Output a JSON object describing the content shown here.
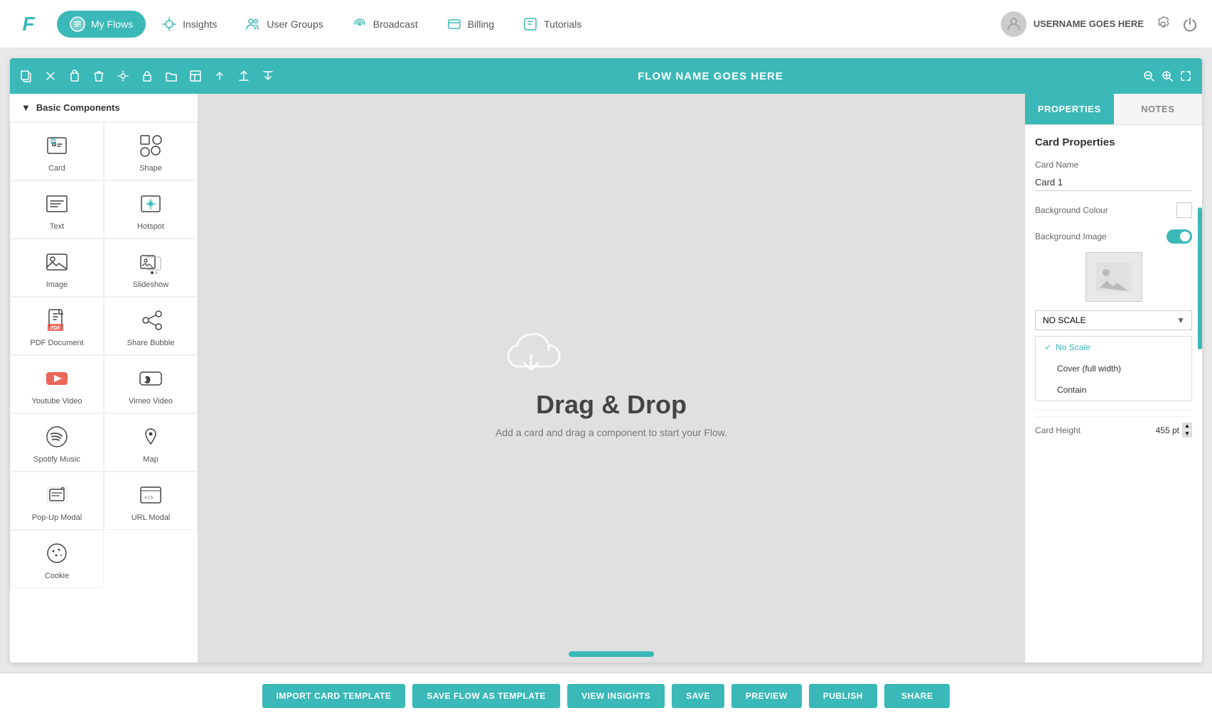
{
  "app": {
    "logo": "F"
  },
  "nav": {
    "items": [
      {
        "id": "my-flows",
        "label": "My Flows",
        "active": true
      },
      {
        "id": "insights",
        "label": "Insights",
        "active": false
      },
      {
        "id": "user-groups",
        "label": "User Groups",
        "active": false
      },
      {
        "id": "broadcast",
        "label": "Broadcast",
        "active": false
      },
      {
        "id": "billing",
        "label": "Billing",
        "active": false
      },
      {
        "id": "tutorials",
        "label": "Tutorials",
        "active": false
      }
    ],
    "username": "USERNAME GOES HERE"
  },
  "toolbar": {
    "title": "FLOW NAME GOES HERE"
  },
  "sidebar": {
    "section_label": "Basic Components",
    "items": [
      {
        "id": "card",
        "label": "Card"
      },
      {
        "id": "shape",
        "label": "Shape"
      },
      {
        "id": "text",
        "label": "Text"
      },
      {
        "id": "hotspot",
        "label": "Hotspot"
      },
      {
        "id": "image",
        "label": "Image"
      },
      {
        "id": "slideshow",
        "label": "Slideshow"
      },
      {
        "id": "pdf-document",
        "label": "PDF Document"
      },
      {
        "id": "share-bubble",
        "label": "Share Bubble"
      },
      {
        "id": "youtube-video",
        "label": "Youtube Video"
      },
      {
        "id": "vimeo-video",
        "label": "Vimeo Video"
      },
      {
        "id": "spotify-music",
        "label": "Spotify Music"
      },
      {
        "id": "map",
        "label": "Map"
      },
      {
        "id": "pop-up-modal",
        "label": "Pop-Up Modal"
      },
      {
        "id": "url-modal",
        "label": "URL Modal"
      },
      {
        "id": "cookie",
        "label": "Cookie"
      }
    ]
  },
  "canvas": {
    "drag_drop_title": "Drag & Drop",
    "drag_drop_subtitle": "Add a card and drag a component to start your Flow."
  },
  "right_panel": {
    "tabs": [
      {
        "id": "properties",
        "label": "PROPERTIES",
        "active": true
      },
      {
        "id": "notes",
        "label": "NOTES",
        "active": false
      }
    ],
    "section_title": "Card Properties",
    "card_name_label": "Card Name",
    "card_name_value": "Card 1",
    "bg_colour_label": "Background Colour",
    "bg_image_label": "Background Image",
    "scale_label": "NO SCALE",
    "scale_options": [
      {
        "id": "no-scale",
        "label": "No Scale",
        "selected": true
      },
      {
        "id": "cover",
        "label": "Cover (full width)",
        "selected": false
      },
      {
        "id": "contain",
        "label": "Contain",
        "selected": false
      }
    ],
    "card_height_label": "Card Height",
    "card_height_value": "455 pt"
  },
  "bottom_bar": {
    "import_label": "IMPORT CARD TEMPLATE",
    "save_template_label": "SAVE FLOW AS TEMPLATE",
    "view_insights_label": "VIEW INSIGHTS",
    "save_label": "SAVE",
    "preview_label": "PREVIEW",
    "publish_label": "PUBLISH",
    "share_label": "SHARE"
  }
}
